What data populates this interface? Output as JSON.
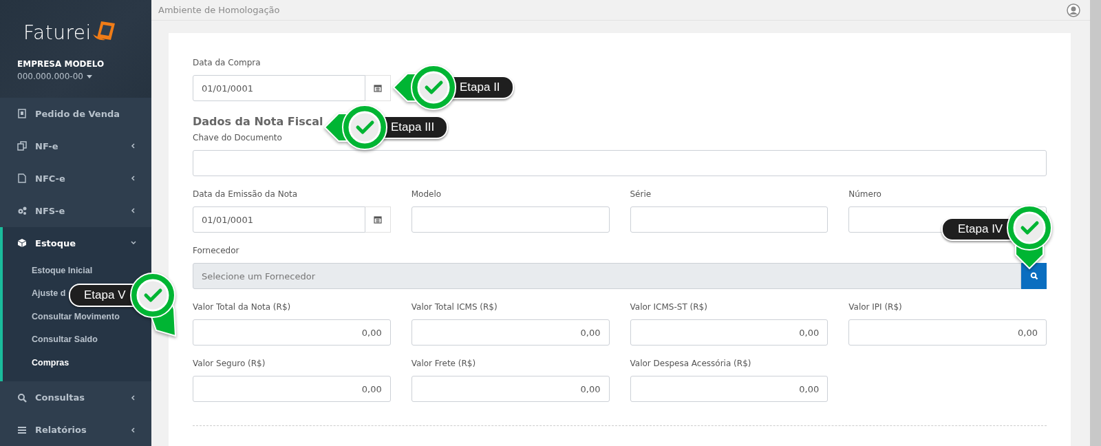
{
  "brand": {
    "name": "Faturei"
  },
  "company": {
    "name": "EMPRESA MODELO",
    "document": "000.000.000-00"
  },
  "sidebar": {
    "items": [
      {
        "label": "Pedido de Venda",
        "kind": "link",
        "selected": false
      },
      {
        "label": "NF-e",
        "kind": "group",
        "expanded": false
      },
      {
        "label": "NFC-e",
        "kind": "group",
        "expanded": false
      },
      {
        "label": "NFS-e",
        "kind": "group",
        "expanded": false
      },
      {
        "label": "Estoque",
        "kind": "group",
        "expanded": true,
        "children": [
          {
            "label": "Estoque Inicial",
            "selected": false
          },
          {
            "label": "Ajuste d",
            "selected": false
          },
          {
            "label": "Consultar Movimento",
            "selected": false
          },
          {
            "label": "Consultar Saldo",
            "selected": false
          },
          {
            "label": "Compras",
            "selected": true
          }
        ]
      },
      {
        "label": "Consultas",
        "kind": "group",
        "expanded": false
      },
      {
        "label": "Relatórios",
        "kind": "group",
        "expanded": false
      }
    ]
  },
  "topbar": {
    "environment": "Ambiente de Homologação"
  },
  "form": {
    "purchase_date": {
      "label": "Data da Compra",
      "value": "01/01/0001"
    },
    "section_title": "Dados da Nota Fiscal",
    "rows": [
      [
        {
          "kind": "text",
          "label": "Chave do Documento"
        }
      ],
      [
        {
          "kind": "date",
          "label": "Data da Emissão da Nota",
          "value": "01/01/0001"
        },
        {
          "kind": "text",
          "label": "Modelo"
        },
        {
          "kind": "text",
          "label": "Série"
        },
        {
          "kind": "text",
          "label": "Número"
        }
      ],
      [
        {
          "kind": "lookup",
          "label": "Fornecedor",
          "placeholder": "Selecione um Fornecedor"
        }
      ],
      [
        {
          "kind": "money",
          "label": "Valor Total da Nota (R$)",
          "value": "0,00"
        },
        {
          "kind": "money",
          "label": "Valor Total ICMS (R$)",
          "value": "0,00"
        },
        {
          "kind": "money",
          "label": "Valor ICMS-ST (R$)",
          "value": "0,00"
        },
        {
          "kind": "money",
          "label": "Valor IPI (R$)",
          "value": "0,00"
        }
      ],
      [
        {
          "kind": "money",
          "label": "Valor Seguro (R$)",
          "value": "0,00"
        },
        {
          "kind": "money",
          "label": "Valor Frete (R$)",
          "value": "0,00"
        },
        {
          "kind": "money",
          "label": "Valor Despesa Acessória (R$)",
          "value": "0,00"
        }
      ]
    ]
  },
  "callouts": [
    {
      "label": "Etapa II"
    },
    {
      "label": "Etapa III"
    },
    {
      "label": "Etapa IV"
    },
    {
      "label": "Etapa V"
    }
  ]
}
